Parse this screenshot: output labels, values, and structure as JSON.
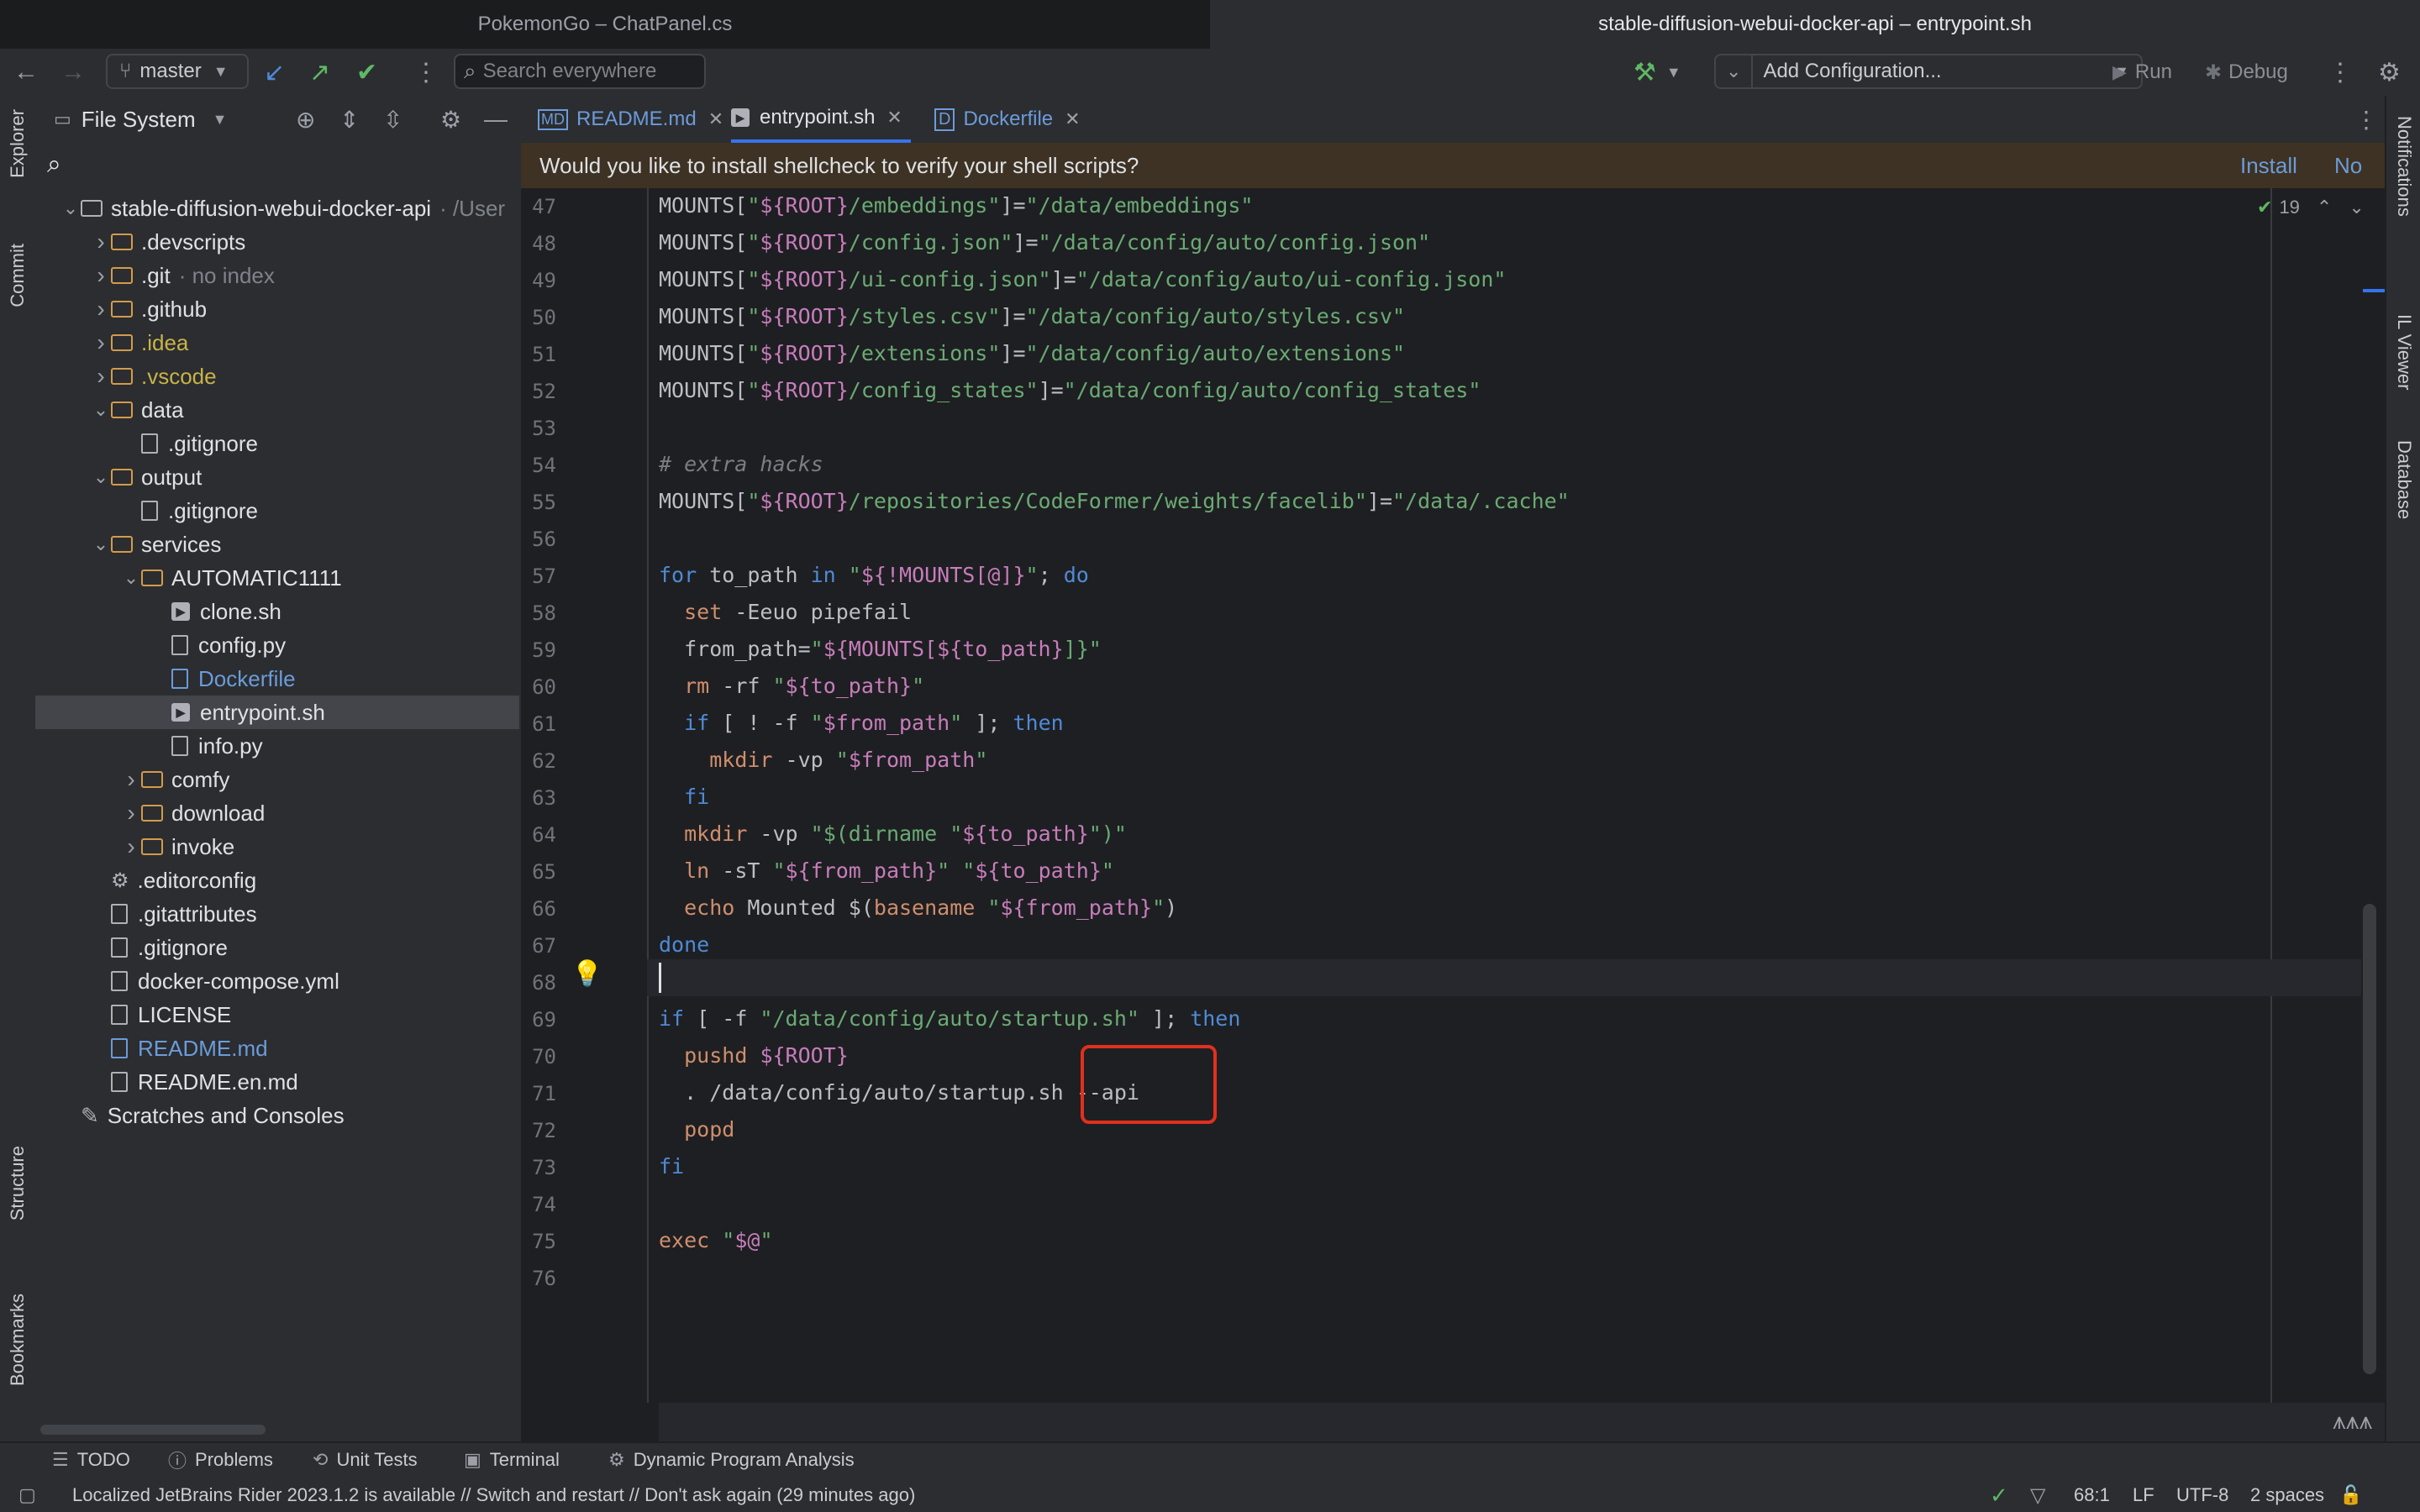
{
  "window": {
    "left_title": "PokemonGo – ChatPanel.cs",
    "right_title": "stable-diffusion-webui-docker-api – entrypoint.sh"
  },
  "toolbar": {
    "branch": "master",
    "search_placeholder": "Search everywhere",
    "config": "Add Configuration...",
    "run": "Run",
    "debug": "Debug"
  },
  "left_stripe": {
    "explorer": "Explorer",
    "commit": "Commit",
    "structure": "Structure",
    "bookmarks": "Bookmarks"
  },
  "right_stripe": {
    "notifications": "Notifications",
    "il_viewer": "IL Viewer",
    "database": "Database"
  },
  "project": {
    "header": "File System",
    "tree": [
      {
        "label": "stable-diffusion-webui-docker-api",
        "hint": "· /User",
        "kind": "root",
        "depth": 0,
        "open": true
      },
      {
        "label": ".devscripts",
        "hint": "",
        "kind": "folder",
        "depth": 1,
        "open": false
      },
      {
        "label": ".git",
        "hint": "· no index",
        "kind": "folder",
        "depth": 1,
        "open": false
      },
      {
        "label": ".github",
        "hint": "",
        "kind": "folder",
        "depth": 1,
        "open": false
      },
      {
        "label": ".idea",
        "hint": "",
        "kind": "folder-yellow",
        "depth": 1,
        "open": false
      },
      {
        "label": ".vscode",
        "hint": "",
        "kind": "folder-yellow",
        "depth": 1,
        "open": false
      },
      {
        "label": "data",
        "hint": "",
        "kind": "folder",
        "depth": 1,
        "open": true
      },
      {
        "label": ".gitignore",
        "hint": "",
        "kind": "file",
        "depth": 2,
        "open": null
      },
      {
        "label": "output",
        "hint": "",
        "kind": "folder",
        "depth": 1,
        "open": true
      },
      {
        "label": ".gitignore",
        "hint": "",
        "kind": "file",
        "depth": 2,
        "open": null
      },
      {
        "label": "services",
        "hint": "",
        "kind": "folder",
        "depth": 1,
        "open": true
      },
      {
        "label": "AUTOMATIC1111",
        "hint": "",
        "kind": "folder",
        "depth": 2,
        "open": true
      },
      {
        "label": "clone.sh",
        "hint": "",
        "kind": "sh",
        "depth": 3,
        "open": null
      },
      {
        "label": "config.py",
        "hint": "",
        "kind": "file",
        "depth": 3,
        "open": null
      },
      {
        "label": "Dockerfile",
        "hint": "",
        "kind": "file-blue",
        "depth": 3,
        "open": null
      },
      {
        "label": "entrypoint.sh",
        "hint": "",
        "kind": "sh-selected",
        "depth": 3,
        "open": null
      },
      {
        "label": "info.py",
        "hint": "",
        "kind": "file",
        "depth": 3,
        "open": null
      },
      {
        "label": "comfy",
        "hint": "",
        "kind": "folder",
        "depth": 2,
        "open": false
      },
      {
        "label": "download",
        "hint": "",
        "kind": "folder",
        "depth": 2,
        "open": false
      },
      {
        "label": "invoke",
        "hint": "",
        "kind": "folder",
        "depth": 2,
        "open": false
      },
      {
        "label": ".editorconfig",
        "hint": "",
        "kind": "gear",
        "depth": 1,
        "open": null
      },
      {
        "label": ".gitattributes",
        "hint": "",
        "kind": "file",
        "depth": 1,
        "open": null
      },
      {
        "label": ".gitignore",
        "hint": "",
        "kind": "file",
        "depth": 1,
        "open": null
      },
      {
        "label": "docker-compose.yml",
        "hint": "",
        "kind": "file",
        "depth": 1,
        "open": null
      },
      {
        "label": "LICENSE",
        "hint": "",
        "kind": "file",
        "depth": 1,
        "open": null
      },
      {
        "label": "README.md",
        "hint": "",
        "kind": "file-blue",
        "depth": 1,
        "open": null
      },
      {
        "label": "README.en.md",
        "hint": "",
        "kind": "file",
        "depth": 1,
        "open": null
      },
      {
        "label": "Scratches and Consoles",
        "hint": "",
        "kind": "scratch",
        "depth": 0,
        "open": null
      }
    ]
  },
  "tabs": [
    {
      "label": "README.md",
      "active": false,
      "color": "#6c9bd9"
    },
    {
      "label": "entrypoint.sh",
      "active": true,
      "color": "#dfe1e5"
    },
    {
      "label": "Dockerfile",
      "active": false,
      "color": "#6c9bd9"
    }
  ],
  "banner": {
    "text": "Would you like to install shellcheck to verify your shell scripts?",
    "install": "Install",
    "no": "No"
  },
  "inspections": {
    "count": "19"
  },
  "code_lines": [
    {
      "n": "47",
      "t": "MOUNTS[\"${ROOT}/embeddings\"]=\"/data/embeddings\""
    },
    {
      "n": "48",
      "t": "MOUNTS[\"${ROOT}/config.json\"]=\"/data/config/auto/config.json\""
    },
    {
      "n": "49",
      "t": "MOUNTS[\"${ROOT}/ui-config.json\"]=\"/data/config/auto/ui-config.json\""
    },
    {
      "n": "50",
      "t": "MOUNTS[\"${ROOT}/styles.csv\"]=\"/data/config/auto/styles.csv\""
    },
    {
      "n": "51",
      "t": "MOUNTS[\"${ROOT}/extensions\"]=\"/data/config/auto/extensions\""
    },
    {
      "n": "52",
      "t": "MOUNTS[\"${ROOT}/config_states\"]=\"/data/config/auto/config_states\""
    },
    {
      "n": "53",
      "t": ""
    },
    {
      "n": "54",
      "t": "# extra hacks"
    },
    {
      "n": "55",
      "t": "MOUNTS[\"${ROOT}/repositories/CodeFormer/weights/facelib\"]=\"/data/.cache\""
    },
    {
      "n": "56",
      "t": ""
    },
    {
      "n": "57",
      "t": "for to_path in \"${!MOUNTS[@]}\"; do"
    },
    {
      "n": "58",
      "t": "  set -Eeuo pipefail"
    },
    {
      "n": "59",
      "t": "  from_path=\"${MOUNTS[${to_path}]}\""
    },
    {
      "n": "60",
      "t": "  rm -rf \"${to_path}\""
    },
    {
      "n": "61",
      "t": "  if [ ! -f \"$from_path\" ]; then"
    },
    {
      "n": "62",
      "t": "    mkdir -vp \"$from_path\""
    },
    {
      "n": "63",
      "t": "  fi"
    },
    {
      "n": "64",
      "t": "  mkdir -vp \"$(dirname \"${to_path}\")\""
    },
    {
      "n": "65",
      "t": "  ln -sT \"${from_path}\" \"${to_path}\""
    },
    {
      "n": "66",
      "t": "  echo Mounted $(basename \"${from_path}\")"
    },
    {
      "n": "67",
      "t": "done"
    },
    {
      "n": "68",
      "t": ""
    },
    {
      "n": "69",
      "t": "if [ -f \"/data/config/auto/startup.sh\" ]; then"
    },
    {
      "n": "70",
      "t": "  pushd ${ROOT}"
    },
    {
      "n": "71",
      "t": "  . /data/config/auto/startup.sh --api"
    },
    {
      "n": "72",
      "t": "  popd"
    },
    {
      "n": "73",
      "t": "fi"
    },
    {
      "n": "74",
      "t": ""
    },
    {
      "n": "75",
      "t": "exec \"$@\""
    },
    {
      "n": "76",
      "t": ""
    }
  ],
  "bottom_tools": [
    "TODO",
    "Problems",
    "Unit Tests",
    "Terminal",
    "Dynamic Program Analysis"
  ],
  "status": {
    "message": "Localized JetBrains Rider 2023.1.2 is available // Switch and restart // Don't ask again (29 minutes ago)",
    "position": "68:1",
    "line_sep": "LF",
    "encoding": "UTF-8",
    "indent": "2 spaces"
  },
  "colors": {
    "accent": "#3574f0",
    "annotation": "#e0301e",
    "banner_bg": "#3d3223"
  }
}
